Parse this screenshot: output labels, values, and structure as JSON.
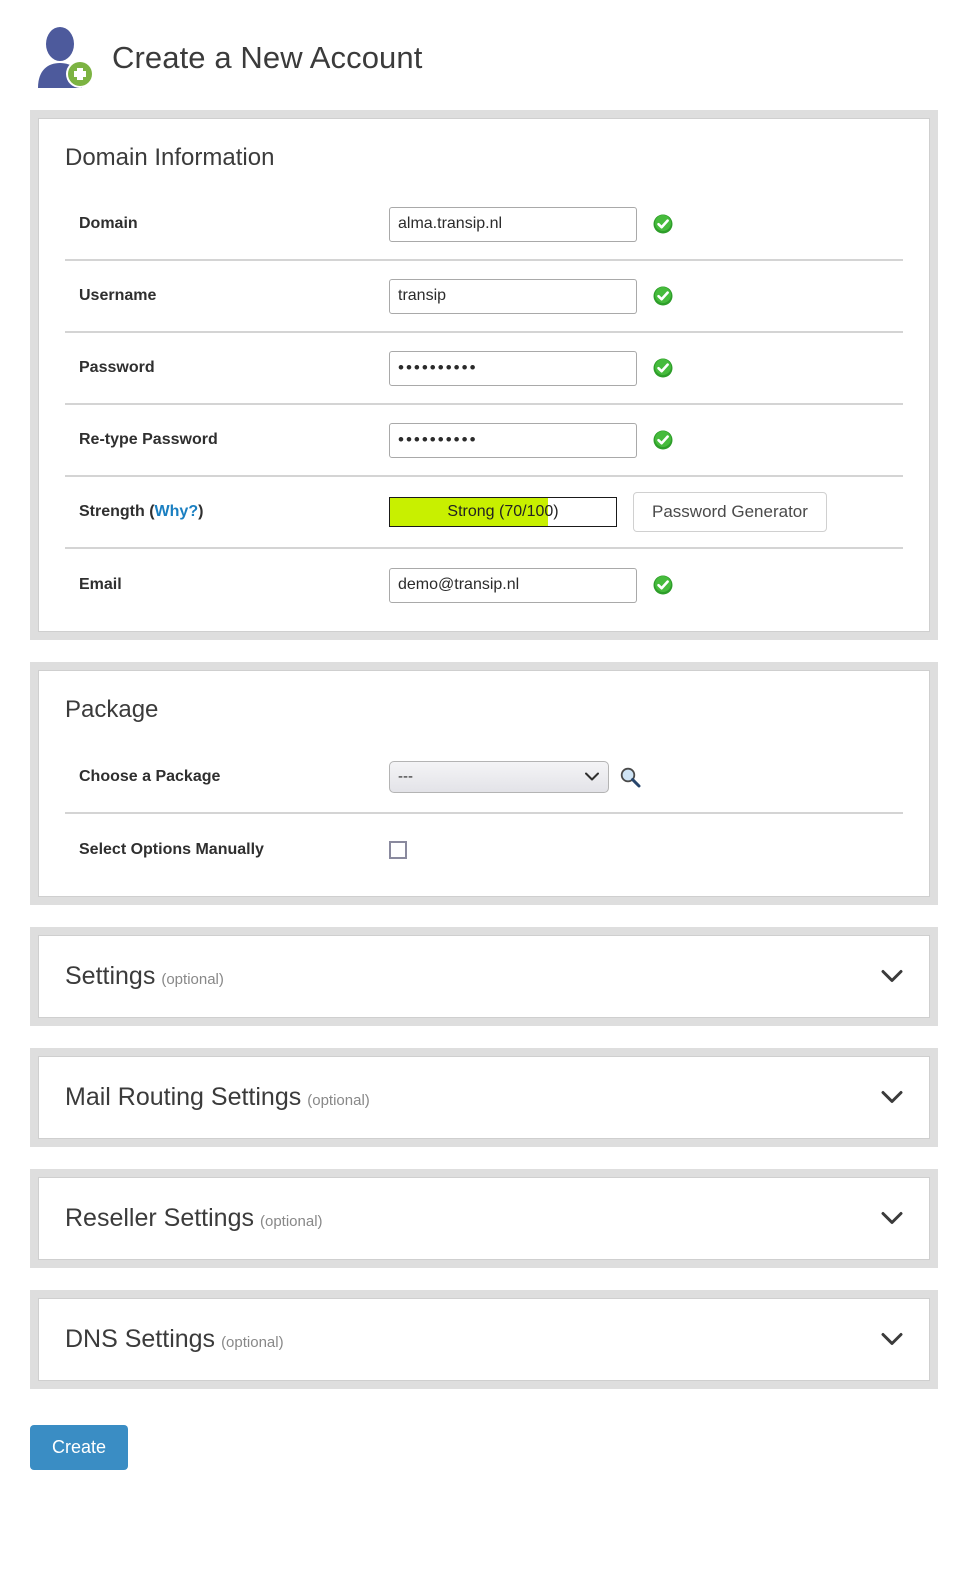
{
  "header": {
    "title": "Create a New Account",
    "icon": "user-add-icon"
  },
  "domain_information": {
    "section_title": "Domain Information",
    "rows": {
      "domain": {
        "label": "Domain",
        "value": "alma.transip.nl",
        "valid_icon": "green-check-icon"
      },
      "username": {
        "label": "Username",
        "value": "transip",
        "valid_icon": "green-check-icon"
      },
      "password": {
        "label": "Password",
        "value": "••••••••••",
        "valid_icon": "green-check-icon"
      },
      "retype_password": {
        "label": "Re-type Password",
        "value": "••••••••••",
        "valid_icon": "green-check-icon"
      },
      "strength": {
        "label_prefix": "Strength (",
        "label_link": "Why?",
        "label_suffix": ")",
        "meter_text": "Strong (70/100)",
        "score": 70,
        "max_score": 100,
        "fill_percent": "70%",
        "fill_color": "#c8f000",
        "generator_button": "Password Generator"
      },
      "email": {
        "label": "Email",
        "value": "demo@transip.nl",
        "valid_icon": "green-check-icon"
      }
    }
  },
  "package": {
    "section_title": "Package",
    "choose_label": "Choose a Package",
    "choose_value": "---",
    "choose_options": [
      "---"
    ],
    "search_icon": "magnifier-icon",
    "manual_label": "Select Options Manually",
    "manual_checked": false
  },
  "collapsible_sections": [
    {
      "title": "Settings",
      "optional": "(optional)",
      "expanded": false,
      "icon": "chevron-down-icon"
    },
    {
      "title": "Mail Routing Settings",
      "optional": "(optional)",
      "expanded": false,
      "icon": "chevron-down-icon"
    },
    {
      "title": "Reseller Settings",
      "optional": "(optional)",
      "expanded": false,
      "icon": "chevron-down-icon"
    },
    {
      "title": "DNS Settings",
      "optional": "(optional)",
      "expanded": false,
      "icon": "chevron-down-icon"
    }
  ],
  "footer": {
    "create_button": "Create"
  },
  "colors": {
    "accent_blue": "#3a8dc4",
    "link_blue": "#1a7fc1",
    "valid_green": "#3aa832",
    "strength_green": "#c8f000",
    "panel_gray": "#dedede",
    "avatar_blue": "#4d5a9c",
    "badge_green": "#7cb342"
  }
}
